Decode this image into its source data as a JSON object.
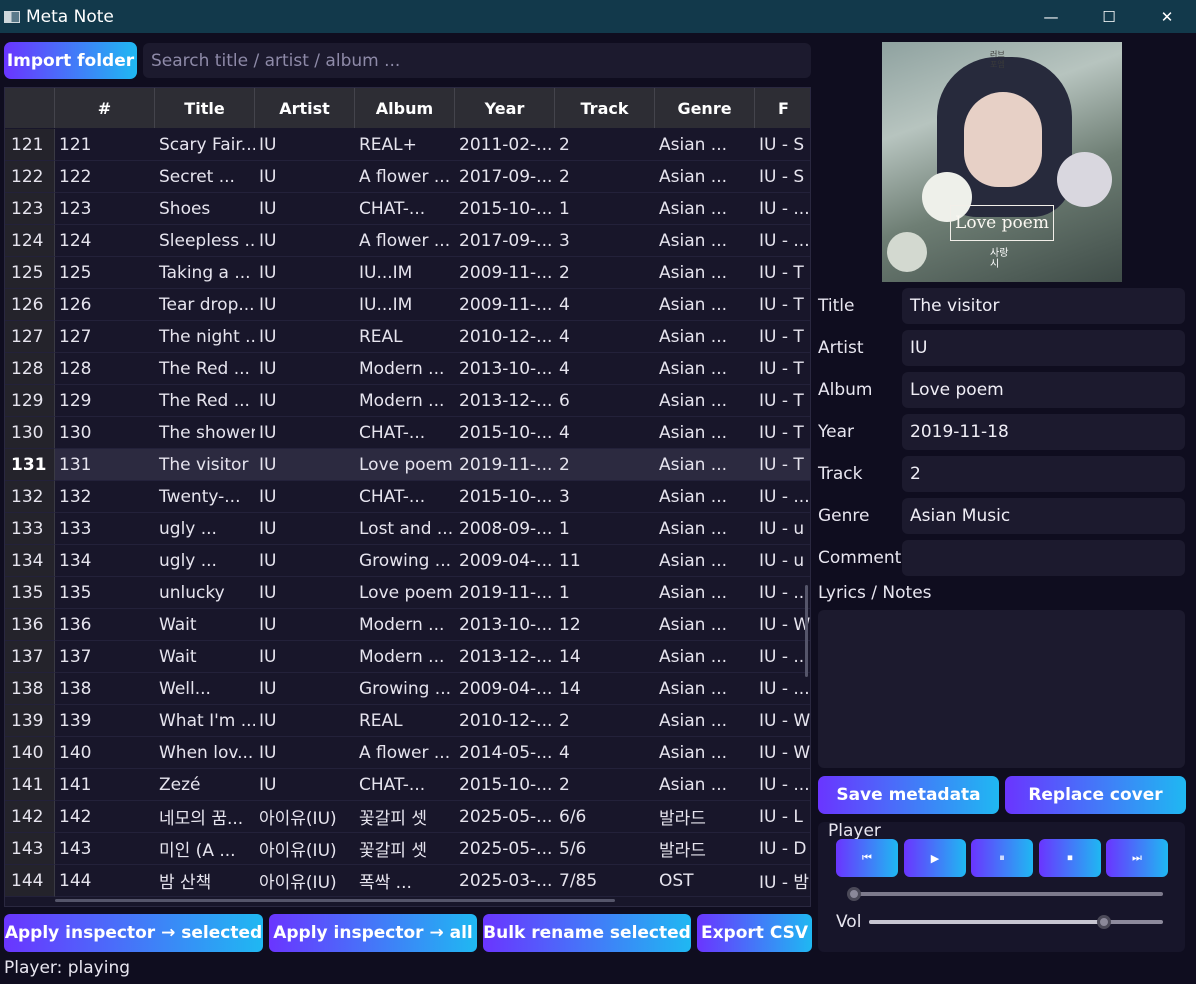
{
  "window": {
    "title": "Meta Note",
    "minimize": "—",
    "maximize": "☐",
    "close": "✕"
  },
  "toolbar": {
    "import_label": "Import folder",
    "search_placeholder": "Search title / artist / album ..."
  },
  "table": {
    "headers": [
      "#",
      "Title",
      "Artist",
      "Album",
      "Year",
      "Track",
      "Genre",
      "F"
    ],
    "rows": [
      {
        "n": "121",
        "id": "121",
        "title": "Scary Fair...",
        "artist": "IU",
        "album": "REAL+",
        "year": "2011-02-...",
        "track": "2",
        "genre": "Asian ...",
        "file": "IU - S"
      },
      {
        "n": "122",
        "id": "122",
        "title": "Secret ...",
        "artist": "IU",
        "album": "A flower ...",
        "year": "2017-09-...",
        "track": "2",
        "genre": "Asian ...",
        "file": "IU - S"
      },
      {
        "n": "123",
        "id": "123",
        "title": "Shoes",
        "artist": "IU",
        "album": "CHAT-...",
        "year": "2015-10-...",
        "track": "1",
        "genre": "Asian ...",
        "file": "IU - ..."
      },
      {
        "n": "124",
        "id": "124",
        "title": "Sleepless ...",
        "artist": "IU",
        "album": "A flower ...",
        "year": "2017-09-...",
        "track": "3",
        "genre": "Asian ...",
        "file": "IU - ..."
      },
      {
        "n": "125",
        "id": "125",
        "title": "Taking a ...",
        "artist": "IU",
        "album": "IU...IM",
        "year": "2009-11-...",
        "track": "2",
        "genre": "Asian ...",
        "file": "IU - T"
      },
      {
        "n": "126",
        "id": "126",
        "title": "Tear drop...",
        "artist": "IU",
        "album": "IU...IM",
        "year": "2009-11-...",
        "track": "4",
        "genre": "Asian ...",
        "file": "IU - T"
      },
      {
        "n": "127",
        "id": "127",
        "title": "The night ...",
        "artist": "IU",
        "album": "REAL",
        "year": "2010-12-...",
        "track": "4",
        "genre": "Asian ...",
        "file": "IU - T"
      },
      {
        "n": "128",
        "id": "128",
        "title": "The Red ...",
        "artist": "IU",
        "album": "Modern ...",
        "year": "2013-10-...",
        "track": "4",
        "genre": "Asian ...",
        "file": "IU - T"
      },
      {
        "n": "129",
        "id": "129",
        "title": "The Red ...",
        "artist": "IU",
        "album": "Modern ...",
        "year": "2013-12-...",
        "track": "6",
        "genre": "Asian ...",
        "file": "IU - T"
      },
      {
        "n": "130",
        "id": "130",
        "title": "The shower",
        "artist": "IU",
        "album": "CHAT-...",
        "year": "2015-10-...",
        "track": "4",
        "genre": "Asian ...",
        "file": "IU - T"
      },
      {
        "n": "131",
        "id": "131",
        "title": "The visitor",
        "artist": "IU",
        "album": "Love poem",
        "year": "2019-11-...",
        "track": "2",
        "genre": "Asian ...",
        "file": "IU - T",
        "selected": true
      },
      {
        "n": "132",
        "id": "132",
        "title": "Twenty-...",
        "artist": "IU",
        "album": "CHAT-...",
        "year": "2015-10-...",
        "track": "3",
        "genre": "Asian ...",
        "file": "IU - ..."
      },
      {
        "n": "133",
        "id": "133",
        "title": "ugly ...",
        "artist": "IU",
        "album": "Lost and ...",
        "year": "2008-09-...",
        "track": "1",
        "genre": "Asian ...",
        "file": "IU - u"
      },
      {
        "n": "134",
        "id": "134",
        "title": "ugly ...",
        "artist": "IU",
        "album": "Growing ...",
        "year": "2009-04-...",
        "track": "11",
        "genre": "Asian ...",
        "file": "IU - u"
      },
      {
        "n": "135",
        "id": "135",
        "title": "unlucky",
        "artist": "IU",
        "album": "Love poem",
        "year": "2019-11-...",
        "track": "1",
        "genre": "Asian ...",
        "file": "IU - ..."
      },
      {
        "n": "136",
        "id": "136",
        "title": "Wait",
        "artist": "IU",
        "album": "Modern ...",
        "year": "2013-10-...",
        "track": "12",
        "genre": "Asian ...",
        "file": "IU - W"
      },
      {
        "n": "137",
        "id": "137",
        "title": "Wait",
        "artist": "IU",
        "album": "Modern ...",
        "year": "2013-12-...",
        "track": "14",
        "genre": "Asian ...",
        "file": "IU - ..."
      },
      {
        "n": "138",
        "id": "138",
        "title": "Well...",
        "artist": "IU",
        "album": "Growing ...",
        "year": "2009-04-...",
        "track": "14",
        "genre": "Asian ...",
        "file": "IU - ..."
      },
      {
        "n": "139",
        "id": "139",
        "title": "What I'm ...",
        "artist": "IU",
        "album": "REAL",
        "year": "2010-12-...",
        "track": "2",
        "genre": "Asian ...",
        "file": "IU - W"
      },
      {
        "n": "140",
        "id": "140",
        "title": "When lov...",
        "artist": "IU",
        "album": "A flower ...",
        "year": "2014-05-...",
        "track": "4",
        "genre": "Asian ...",
        "file": "IU - W"
      },
      {
        "n": "141",
        "id": "141",
        "title": "Zezé",
        "artist": "IU",
        "album": "CHAT-...",
        "year": "2015-10-...",
        "track": "2",
        "genre": "Asian ...",
        "file": "IU - ..."
      },
      {
        "n": "142",
        "id": "142",
        "title": "네모의 꿈...",
        "artist": "아이유(IU)",
        "album": "꽃갈피 셋",
        "year": "2025-05-...",
        "track": "6/6",
        "genre": "발라드",
        "file": "IU - L"
      },
      {
        "n": "143",
        "id": "143",
        "title": "미인 (A ...",
        "artist": "아이유(IU)",
        "album": "꽃갈피 셋",
        "year": "2025-05-...",
        "track": "5/6",
        "genre": "발라드",
        "file": "IU - D"
      },
      {
        "n": "144",
        "id": "144",
        "title": "밤 산책",
        "artist": "아이유(IU)",
        "album": "폭싹 ...",
        "year": "2025-03-...",
        "track": "7/85",
        "genre": "OST",
        "file": "IU - 밤"
      }
    ]
  },
  "bottom_buttons": {
    "apply_selected": "Apply inspector → selected",
    "apply_all": "Apply inspector → all",
    "bulk_rename": "Bulk rename selected",
    "export_csv": "Export CSV"
  },
  "status": "Player: playing",
  "cover": {
    "title_text": "Love poem",
    "korean_bottom": "사랑\n시",
    "korean_top": "러브\n포엠"
  },
  "inspector": {
    "title_label": "Title",
    "title_value": "The visitor",
    "artist_label": "Artist",
    "artist_value": "IU",
    "album_label": "Album",
    "album_value": "Love poem",
    "year_label": "Year",
    "year_value": "2019-11-18",
    "track_label": "Track",
    "track_value": "2",
    "genre_label": "Genre",
    "genre_value": "Asian Music",
    "comment_label": "Comment",
    "comment_value": "",
    "notes_label": "Lyrics / Notes",
    "notes_value": ""
  },
  "actions": {
    "save": "Save metadata",
    "replace_cover": "Replace cover"
  },
  "player": {
    "label": "Player",
    "prev_icon": "⏮",
    "play_icon": "▶",
    "pause_icon": "⏸",
    "stop_icon": "⏹",
    "next_icon": "⏭",
    "vol_label": "Vol",
    "seek_fraction": 0.02,
    "volume_fraction": 0.8
  }
}
